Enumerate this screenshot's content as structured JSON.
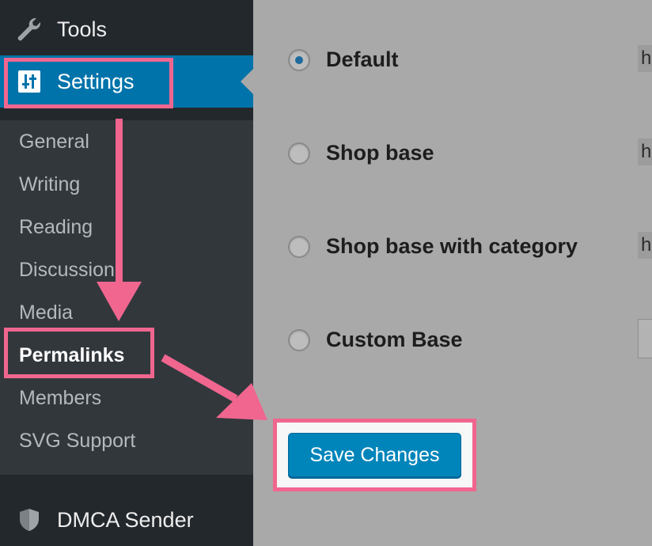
{
  "sidebar": {
    "tools_label": "Tools",
    "settings_label": "Settings",
    "dmca_label": "DMCA Sender",
    "submenu": [
      "General",
      "Writing",
      "Reading",
      "Discussion",
      "Media",
      "Permalinks",
      "Members",
      "SVG Support"
    ]
  },
  "main": {
    "options": [
      {
        "label": "Default",
        "checked": true,
        "value_preview": "h"
      },
      {
        "label": "Shop base",
        "checked": false,
        "value_preview": "h"
      },
      {
        "label": "Shop base with category",
        "checked": false,
        "value_preview": "h"
      },
      {
        "label": "Custom Base",
        "checked": false,
        "value_preview": ""
      }
    ],
    "save_label": "Save Changes"
  },
  "colors": {
    "sidebar_bg": "#23282d",
    "submenu_bg": "#32373c",
    "active_menu": "#0073aa",
    "highlight": "#f0668f",
    "button": "#0085ba"
  },
  "icons": {
    "tools": "wrench-icon",
    "settings": "sliders-icon",
    "dmca": "shield-icon"
  }
}
